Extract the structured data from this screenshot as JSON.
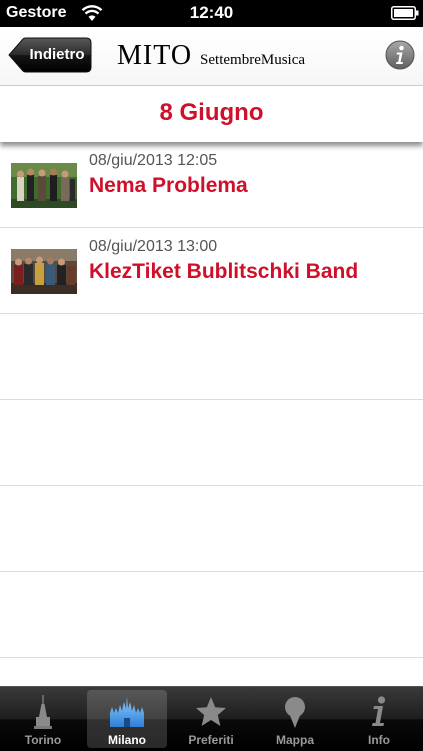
{
  "status_bar": {
    "carrier": "Gestore",
    "time": "12:40",
    "wifi_icon": "wifi-icon",
    "battery_icon": "battery-icon"
  },
  "nav_bar": {
    "back_label": "Indietro",
    "logo_main": "MITO",
    "logo_sub": "SettembreMusica",
    "info_icon": "info-icon"
  },
  "date_header": {
    "title": "8 Giugno"
  },
  "events": [
    {
      "datetime": "08/giu/2013 12:05",
      "title": "Nema Problema",
      "thumb_icon": "band-photo"
    },
    {
      "datetime": "08/giu/2013 13:00",
      "title": "KlezTiket Bublitschki Band",
      "thumb_icon": "band-photo"
    }
  ],
  "tabs": [
    {
      "label": "Torino",
      "icon": "mole-antonelliana-icon",
      "selected": false
    },
    {
      "label": "Milano",
      "icon": "duomo-icon",
      "selected": true
    },
    {
      "label": "Preferiti",
      "icon": "star-icon",
      "selected": false
    },
    {
      "label": "Mappa",
      "icon": "map-pin-icon",
      "selected": false
    },
    {
      "label": "Info",
      "icon": "info-icon",
      "selected": false
    }
  ],
  "colors": {
    "accent_red": "#d0102a",
    "tab_bar": "#1a1a1a"
  }
}
